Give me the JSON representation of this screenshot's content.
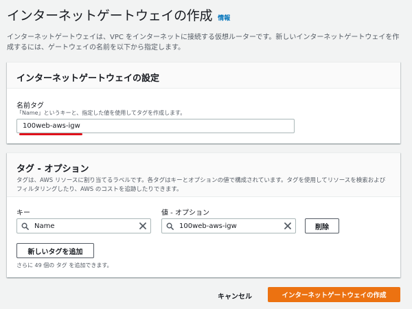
{
  "page": {
    "title": "インターネットゲートウェイの作成",
    "info_link": "情報",
    "description": "インターネットゲートウェイは、VPC をインターネットに接続する仮想ルーターです。新しいインターネットゲートウェイを作成するには、ゲートウェイの名前を以下から指定します。"
  },
  "settings": {
    "title": "インターネットゲートウェイの設定",
    "name_tag_label": "名前タグ",
    "name_tag_hint": "「Name」というキーと、指定した値を使用してタグを作成します。",
    "name_tag_value": "100web-aws-igw"
  },
  "tags": {
    "title": "タグ - オプション",
    "description": "タグは、AWS リソースに割り当てるラベルです。各タグはキーとオプションの値で構成されています。タグを使用してリソースを検索およびフィルタリングしたり、AWS のコストを追跡したりできます。",
    "key_label": "キー",
    "value_label": "値 - オプション",
    "key_value": "Name",
    "value_value": "100web-aws-igw",
    "remove_label": "削除",
    "add_tag_label": "新しいタグを追加",
    "remaining_hint": "さらに 49 個の タグ を追加できます。"
  },
  "footer": {
    "cancel_label": "キャンセル",
    "create_label": "インターネットゲートウェイの作成"
  },
  "colors": {
    "primary": "#ec7211",
    "link": "#0073bb",
    "annotation": "#e0121b"
  },
  "icons": {
    "search": "search-icon",
    "clear": "close-icon"
  }
}
